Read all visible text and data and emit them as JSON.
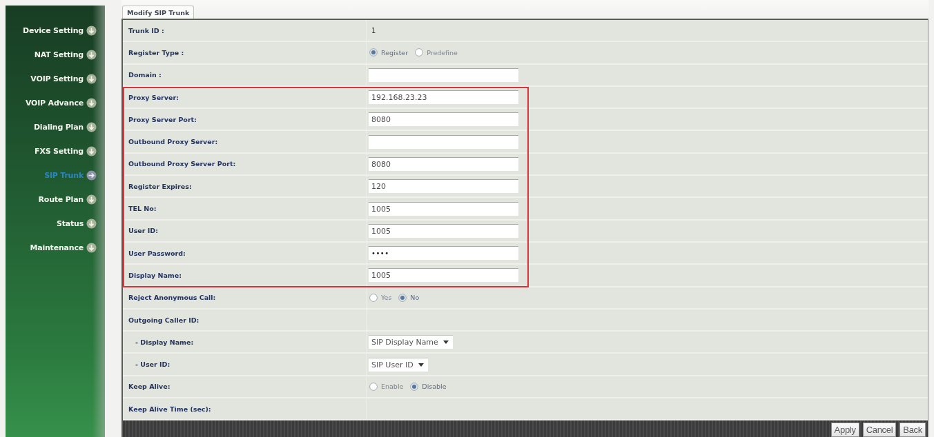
{
  "sidebar": {
    "items": [
      {
        "label": "Device Setting",
        "selected": false
      },
      {
        "label": "NAT Setting",
        "selected": false
      },
      {
        "label": "VOIP Setting",
        "selected": false
      },
      {
        "label": "VOIP Advance",
        "selected": false
      },
      {
        "label": "Dialing Plan",
        "selected": false
      },
      {
        "label": "FXS Setting",
        "selected": false
      },
      {
        "label": "SIP Trunk",
        "selected": true
      },
      {
        "label": "Route Plan",
        "selected": false
      },
      {
        "label": "Status",
        "selected": false
      },
      {
        "label": "Maintenance",
        "selected": false
      }
    ]
  },
  "tabs": [
    {
      "label": "Modify SIP Trunk",
      "selected": true
    }
  ],
  "form": {
    "sections": [
      {
        "highlighted": false,
        "rows": [
          {
            "label": "Trunk ID :",
            "kind": "text",
            "value": "1"
          },
          {
            "label": "Register Type :",
            "kind": "radio",
            "options": [
              {
                "label": "Register",
                "selected": true
              },
              {
                "label": "Predefine",
                "selected": false
              }
            ]
          },
          {
            "label": "Domain :",
            "kind": "input"
          }
        ]
      },
      {
        "highlighted": true,
        "rows": [
          {
            "label": "Proxy Server:",
            "kind": "input",
            "value": "192.168.23.23"
          },
          {
            "label": "Proxy Server Port:",
            "kind": "input",
            "value": "8080"
          },
          {
            "label": "Outbound Proxy Server:",
            "kind": "input"
          },
          {
            "label": "Outbound Proxy Server Port:",
            "kind": "input",
            "value": "8080"
          },
          {
            "label": "Register Expires:",
            "kind": "input",
            "value": "120"
          },
          {
            "label": "TEL No:",
            "kind": "input",
            "value": "1005"
          },
          {
            "label": "User ID:",
            "kind": "input",
            "value": "1005"
          },
          {
            "label": "User Password:",
            "kind": "password",
            "value": "••••"
          },
          {
            "label": "Display Name:",
            "kind": "input",
            "value": "1005"
          }
        ]
      },
      {
        "highlighted": false,
        "rows": [
          {
            "label": "Reject Anonymous Call:",
            "kind": "radio",
            "options": [
              {
                "label": "Yes",
                "selected": false
              },
              {
                "label": "No",
                "selected": true
              }
            ]
          },
          {
            "label": "Outgoing Caller ID:",
            "kind": "none",
            "children": [
              {
                "label": "- Display Name:",
                "kind": "select",
                "value": "SIP Display Name"
              },
              {
                "label": "- User ID:",
                "kind": "select",
                "value": "SIP User ID"
              }
            ]
          },
          {
            "label": "Keep Alive:",
            "kind": "radio",
            "options": [
              {
                "label": "Enable",
                "selected": false
              },
              {
                "label": "Disable",
                "selected": true
              }
            ]
          },
          {
            "label": "Keep Alive Time (sec):",
            "kind": "none"
          }
        ]
      }
    ]
  },
  "footer": {
    "buttons": [
      "Apply",
      "Cancel",
      "Back"
    ]
  }
}
